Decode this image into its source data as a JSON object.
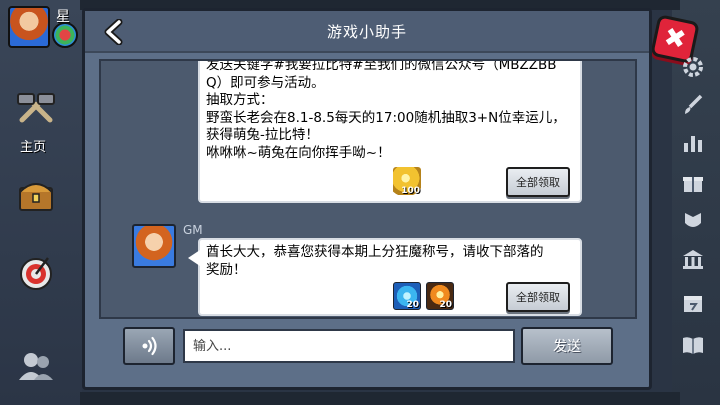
{
  "window": {
    "title": "游戏小助手"
  },
  "player": {
    "name": "星"
  },
  "left_nav": {
    "home_label": "主页"
  },
  "messages": [
    {
      "lines": [
        "发送关键字#我要拉比特#至我们的微信公众号（MBZZBB",
        "Q）即可参与活动。",
        "抽取方式：",
        "野蛮长老会在8.1-8.5每天的17:00随机抽取3+N位幸运儿，",
        "获得萌兔-拉比特！",
        "咻咻咻~萌兔在向你挥手呦~！"
      ],
      "rewards": [
        {
          "icon": "gold-coin-icon",
          "count": "100"
        }
      ],
      "claim_label": "全部领取"
    },
    {
      "sender": "GM",
      "lines": [
        "酋长大大，恭喜您获得本期上分狂魔称号，请收下部落的",
        "奖励！"
      ],
      "rewards": [
        {
          "icon": "blue-potion-icon",
          "count": "20"
        },
        {
          "icon": "fire-potion-icon",
          "count": "20"
        }
      ],
      "claim_label": "全部领取"
    }
  ],
  "input": {
    "placeholder": "输入..."
  },
  "send_label": "发送",
  "colors": {
    "dialog_bg": "#5d6f88",
    "chat_bg": "#4c5a6e",
    "close_red": "#e0243a"
  }
}
